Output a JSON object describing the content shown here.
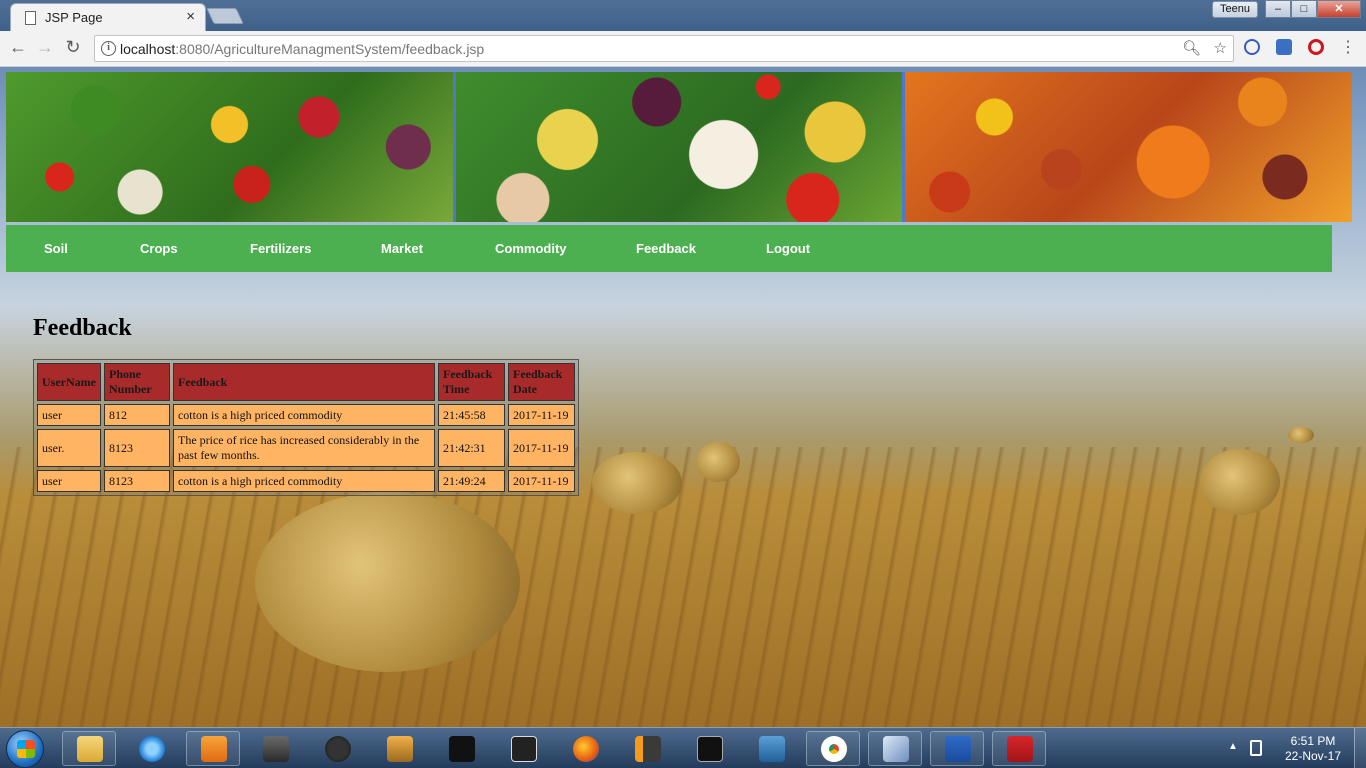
{
  "browser": {
    "tab_title": "JSP Page",
    "tab_close": "×",
    "profile_name": "Teenu",
    "url_host": "localhost",
    "url_rest": ":8080/AgricultureManagmentSystem/feedback.jsp",
    "window_controls": {
      "minimize": "–",
      "maximize": "□",
      "close": "✕"
    },
    "nav": {
      "back": "←",
      "forward": "→",
      "reload": "↻"
    }
  },
  "menu": {
    "items": [
      "Soil",
      "Crops",
      "Fertilizers",
      "Market",
      "Commodity",
      "Feedback",
      "Logout"
    ]
  },
  "page": {
    "title": "Feedback"
  },
  "table": {
    "headers": [
      "UserName",
      "Phone Number",
      "Feedback",
      "Feedback Time",
      "Feedback Date"
    ],
    "rows": [
      [
        "user",
        "812",
        "cotton is a high priced commodity",
        "21:45:58",
        "2017-11-19"
      ],
      [
        "user.",
        "8123",
        "The price of rice has increased considerably in the past few months.",
        "21:42:31",
        "2017-11-19"
      ],
      [
        "user",
        "8123",
        "cotton is a high priced commodity",
        "21:49:24",
        "2017-11-19"
      ]
    ]
  },
  "taskbar": {
    "time": "6:51 PM",
    "date": "22-Nov-17",
    "apps": [
      "file-explorer",
      "internet-explorer",
      "media-player",
      "game-app",
      "pes-15",
      "counter-strike",
      "wwe",
      "sleeping-dogs",
      "firefox",
      "sublime-text",
      "mysql",
      "mysql-workbench",
      "chrome",
      "virtualbox",
      "word",
      "acrobat"
    ]
  },
  "colors": {
    "nav_green": "#4caf50",
    "header_cell": "#a82a2a",
    "body_cell": "#ffb463"
  }
}
